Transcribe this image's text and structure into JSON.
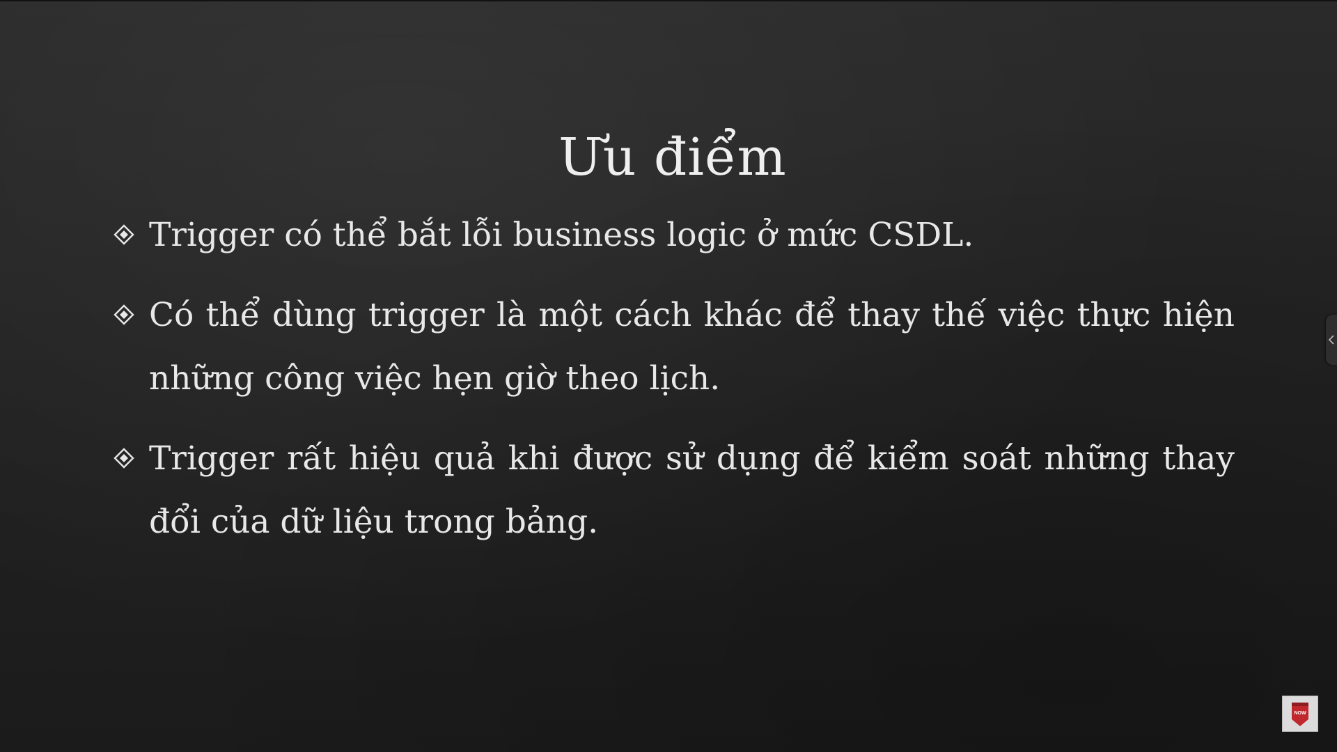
{
  "slide": {
    "title": "Ưu điểm",
    "bullets": [
      "Trigger có thể bắt lỗi business logic ở mức CSDL.",
      "Có thể dùng trigger là một cách khác để thay thế việc thực hiện những công việc hẹn giờ theo lịch.",
      "Trigger rất hiệu quả khi được sử dụng để kiểm soát những thay đổi của dữ liệu trong bảng."
    ],
    "bullet_icon": "diamond-bullet-icon"
  },
  "side_panel": {
    "icon": "chevron-left-icon"
  },
  "watermark": {
    "icon": "channel-logo-icon",
    "text": "NOW"
  },
  "colors": {
    "background": "#232323",
    "text": "#ececec",
    "logo_accent": "#c0282d"
  }
}
